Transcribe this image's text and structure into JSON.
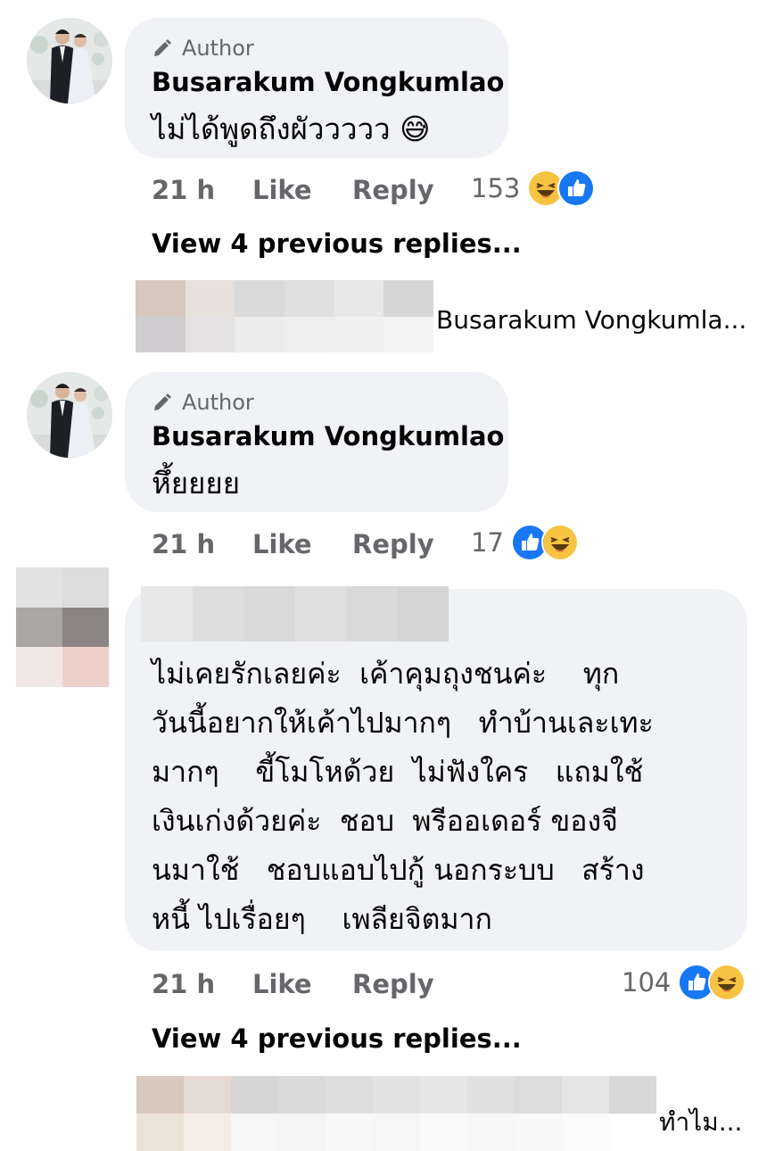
{
  "comments": [
    {
      "author_badge": "Author",
      "name": "Busarakum Vongkumlao",
      "text": "ไม่ได้พูดถึงผัววววว 😅",
      "time": "21 h",
      "like": "Like",
      "reply": "Reply",
      "reaction_count": "153",
      "reactions": [
        "haha-icon",
        "like-icon"
      ]
    },
    {
      "author_badge": "Author",
      "name": "Busarakum Vongkumlao",
      "text": "หึ้ยยยย",
      "time": "21 h",
      "like": "Like",
      "reply": "Reply",
      "reaction_count": "17",
      "reactions": [
        "like-icon",
        "haha-icon"
      ]
    },
    {
      "text_lines": [
        "ไม่เคยรักเลยค่ะ  เค้าคุมถุงชนค่ะ    ทุก",
        "วันนี้อยากให้เค้าไปมากๆ   ทำบ้านเละเทะ",
        "มากๆ    ขี้โมโหด้วย  ไม่ฟังใคร   แถมใช้",
        "เงินเก่งด้วยค่ะ  ชอบ  พรีออเดอร์ ของจี",
        "นมาใช้   ชอบแอบไปกู้ นอกระบบ   สร้าง",
        "หนี้ ไปเรื่อยๆ    เพลียจิตมาก"
      ],
      "time": "21 h",
      "like": "Like",
      "reply": "Reply",
      "reaction_count": "104",
      "reactions": [
        "like-icon",
        "haha-icon"
      ]
    }
  ],
  "view_previous": [
    "View 4 previous replies...",
    "View 4 previous replies..."
  ],
  "reply_previews": [
    "Busarakum Vongkumla...",
    "ทำไม..."
  ],
  "colors": {
    "bubble": "#f0f2f5",
    "secondary_text": "#65676b",
    "like_blue": "#1877f2",
    "haha_yellow": "#f7c342"
  }
}
